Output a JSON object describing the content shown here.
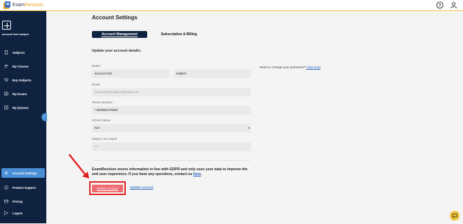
{
  "app": {
    "name_prefix": "Exam",
    "name_accent": "Revision"
  },
  "sidebar": {
    "subject_name": "account test subject",
    "items": [
      {
        "label": "Subjects",
        "icon": "phone-icon"
      },
      {
        "label": "My Classes",
        "icon": "people-icon"
      },
      {
        "label": "Buy Subjects",
        "icon": "cart-icon"
      },
      {
        "label": "My Exams",
        "icon": "book-icon"
      },
      {
        "label": "My Quizzes",
        "icon": "checkbox-icon"
      },
      {
        "label": "Account Settings",
        "icon": "gear-icon",
        "active": true
      },
      {
        "label": "Product Support",
        "icon": "help-icon"
      },
      {
        "label": "Pricing",
        "icon": "card-icon"
      },
      {
        "label": "Logout",
        "icon": "logout-icon"
      }
    ]
  },
  "page": {
    "title": "Account Settings",
    "tabs": [
      {
        "label": "Account Management",
        "active": true
      },
      {
        "label": "Subscription & Billing",
        "active": false
      }
    ],
    "section_title": "Update your account details:"
  },
  "form": {
    "name_label": "Name:",
    "first_name": "account test",
    "last_name": "subject",
    "email_label": "Email:",
    "email": "accounttestsubject@gmail.com",
    "phone_label": "Phone Number:",
    "phone": "+353892476684",
    "school_label": "School Name:",
    "school": "N/A",
    "subject_label": "Subject You Teach:",
    "subject": "---"
  },
  "password": {
    "text": "Need to change your password?",
    "link": "Click here"
  },
  "gdpr": {
    "text": "ExamRevision stores information in line with GDPR and only uses your data to improve the end user experience. If you have any questions, contact us",
    "link": "here",
    "end": "."
  },
  "actions": {
    "delete": "Delete Account",
    "update": "Update Account"
  },
  "colors": {
    "sidebar": "#0f2240",
    "active": "#4a8fd6",
    "accent": "#f0c43a",
    "delete": "#f06a72",
    "annotation": "#e02020",
    "link": "#1f5fb8"
  }
}
